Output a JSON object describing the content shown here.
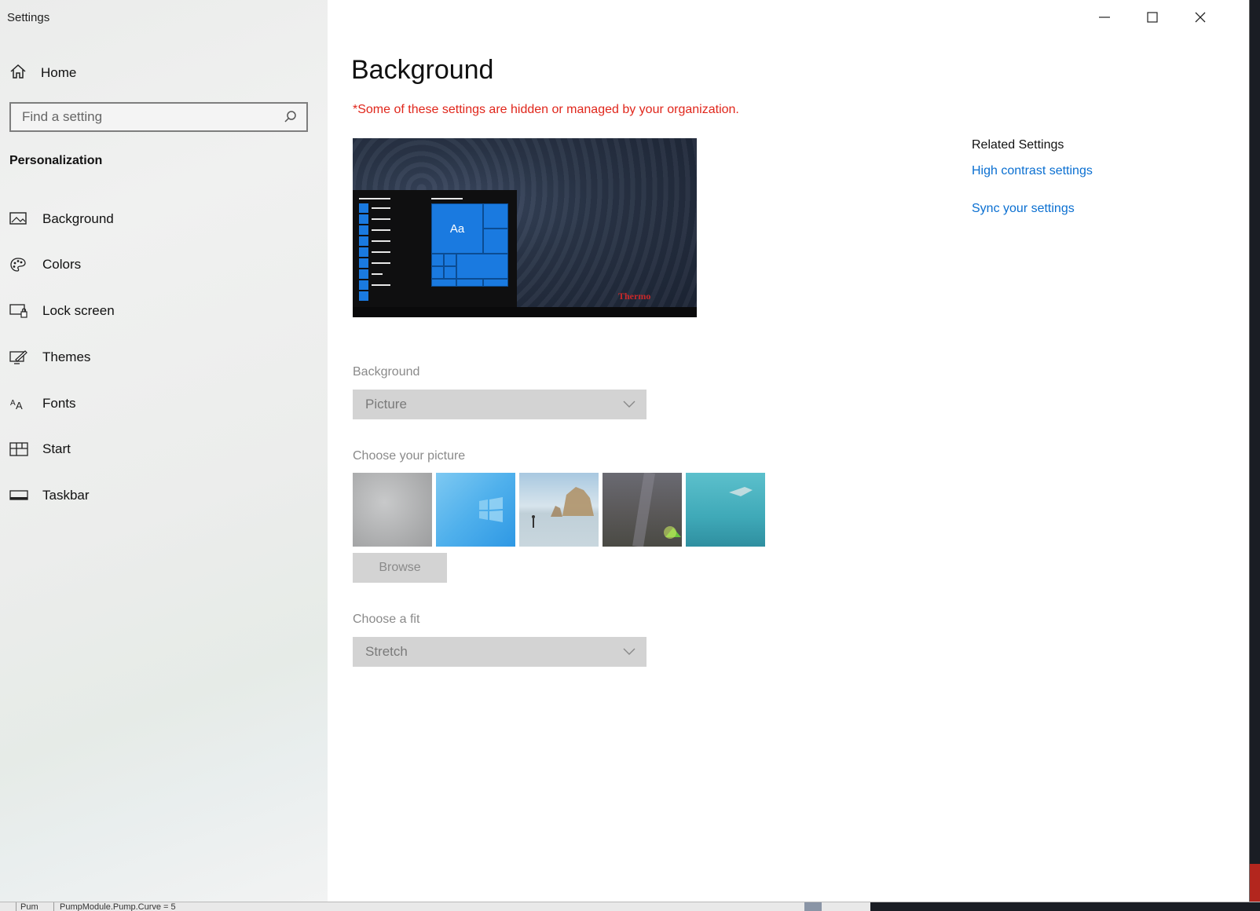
{
  "window": {
    "title": "Settings"
  },
  "sidebar": {
    "home_label": "Home",
    "search_placeholder": "Find a setting",
    "section_title": "Personalization",
    "items": [
      {
        "label": "Background",
        "icon": "picture-icon"
      },
      {
        "label": "Colors",
        "icon": "palette-icon"
      },
      {
        "label": "Lock screen",
        "icon": "lock-screen-icon"
      },
      {
        "label": "Themes",
        "icon": "themes-icon"
      },
      {
        "label": "Fonts",
        "icon": "fonts-icon"
      },
      {
        "label": "Start",
        "icon": "start-icon"
      },
      {
        "label": "Taskbar",
        "icon": "taskbar-icon"
      }
    ]
  },
  "main": {
    "title": "Background",
    "warning": "*Some of these settings are hidden or managed by your organization.",
    "preview": {
      "tile_label": "Aa",
      "brand_text": "Thermo"
    },
    "background_label": "Background",
    "background_value": "Picture",
    "choose_picture_label": "Choose your picture",
    "browse_label": "Browse",
    "choose_fit_label": "Choose a fit",
    "fit_value": "Stretch"
  },
  "related": {
    "title": "Related Settings",
    "links": [
      "High contrast settings",
      "Sync your settings"
    ]
  },
  "statusbar": {
    "cell1": "Pum",
    "cell2": "PumpModule.Pump.Curve = 5"
  },
  "colors": {
    "accent": "#0a6fd1",
    "warning": "#e0261b",
    "tile_blue": "#1a7ae0"
  }
}
